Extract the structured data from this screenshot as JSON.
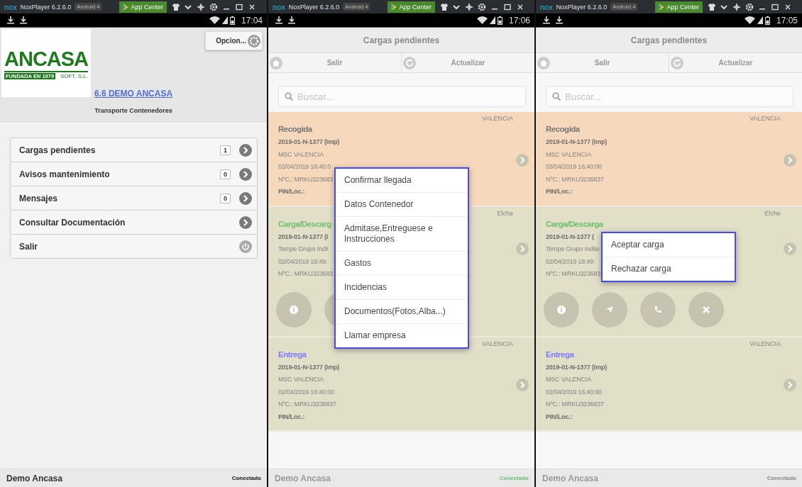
{
  "windows": [
    {
      "logo": "nox",
      "title": "NoxPlayer 6.2.6.0",
      "android": "Android 4",
      "app_center": "App Center",
      "time": "17:04",
      "dimmed": false,
      "screen": {
        "kind": "home",
        "logo": {
          "name": "ANCASA",
          "founded": "FUNDADA EN 1979",
          "company": "SOFT, S.L."
        },
        "options_button": "Opcion...",
        "link": "6.6 DEMO ANCASA",
        "subtitle": "Transporte Contenedores",
        "menu": [
          {
            "label": "Cargas pendientes",
            "count": "1",
            "kind": "arrow"
          },
          {
            "label": "Avisos mantenimiento",
            "count": "0",
            "kind": "arrow"
          },
          {
            "label": "Mensajes",
            "count": "0",
            "kind": "arrow"
          },
          {
            "label": "Consultar Documentación",
            "kind": "arrow"
          },
          {
            "label": "Salir",
            "kind": "power"
          }
        ]
      },
      "footer": {
        "name": "Demo Ancasa",
        "status": "Conectado",
        "color": "#111111"
      }
    },
    {
      "logo": "nox",
      "title": "NoxPlayer 6.2.6.0",
      "android": "Android 4",
      "app_center": "App Center",
      "time": "17:06",
      "dimmed": true,
      "screen": {
        "kind": "list",
        "title": "Cargas pendientes",
        "toolbar": [
          {
            "label": "Salir",
            "kind": "home"
          },
          {
            "label": "Actualizar",
            "kind": "refresh"
          }
        ],
        "search": {
          "placeholder": "Buscar..."
        },
        "cards": [
          {
            "location": "VALENCIA",
            "title": "Recogida",
            "color": "#777777",
            "selected": true,
            "lines": [
              {
                "text": "2019-01-N-1377 (Imp)",
                "kind": "bold"
              },
              {
                "text": "MSC VALENCIA",
                "kind": "plain"
              },
              {
                "text": "03/04/2019 16:40:0",
                "kind": "plain"
              },
              {
                "text": "NºC.: MRKU323683",
                "kind": "plain"
              },
              {
                "text": "PIN/Loc.:",
                "kind": "bold"
              }
            ]
          },
          {
            "location": "Elche",
            "title": "Carga/Descarg",
            "color": "#6dbf6d",
            "selected": false,
            "lines": [
              {
                "text": "2019-01-N-1377 (I",
                "kind": "bold"
              },
              {
                "text": "Tempe Grupo Indit",
                "kind": "plain"
              },
              {
                "text": "02/04/2019 18:49:",
                "kind": "plain"
              },
              {
                "text": "NºC.: MRKU323683",
                "kind": "plain"
              }
            ],
            "actions": [
              {
                "kind": "info"
              },
              {
                "kind": "hidden"
              }
            ]
          },
          {
            "location": "VALENCIA",
            "title": "Entrega",
            "color": "#7b7bff",
            "selected": false,
            "lines": [
              {
                "text": "2019-01-N-1377 (Imp)",
                "kind": "bold"
              },
              {
                "text": "MSC VALENCIA",
                "kind": "plain"
              },
              {
                "text": "02/04/2019 16:40:00",
                "kind": "plain"
              },
              {
                "text": "NºC.: MRKU3236837",
                "kind": "plain"
              },
              {
                "text": "PIN/Loc.:",
                "kind": "bold"
              }
            ]
          }
        ],
        "popup": {
          "items": [
            {
              "label": "Confirmar llegada"
            },
            {
              "label": "Datos Contenedor"
            },
            {
              "label": "Admitase,Entreguese e Instrucciones"
            },
            {
              "label": "Gastos"
            },
            {
              "label": "Incidencias"
            },
            {
              "label": "Documentos(Fotos,Alba...)"
            },
            {
              "label": "Llamar empresa"
            }
          ]
        }
      },
      "footer": {
        "name": "Demo Ancasa",
        "status": "Conectado",
        "color": "#6dbf6d"
      }
    },
    {
      "logo": "nox",
      "title": "NoxPlayer 6.2.6.0",
      "android": "Android 4",
      "app_center": "App Center",
      "time": "17:05",
      "dimmed": true,
      "screen": {
        "kind": "list",
        "title": "Cargas pendientes",
        "toolbar": [
          {
            "label": "Salir",
            "kind": "home"
          },
          {
            "label": "Actualizar",
            "kind": "refresh"
          }
        ],
        "search": {
          "placeholder": "Buscar..."
        },
        "cards": [
          {
            "location": "VALENCIA",
            "title": "Recogida",
            "color": "#777777",
            "selected": true,
            "lines": [
              {
                "text": "2019-01-N-1377 (Imp)",
                "kind": "bold"
              },
              {
                "text": "MSC VALENCIA",
                "kind": "plain"
              },
              {
                "text": "03/04/2019 16:40:00",
                "kind": "plain"
              },
              {
                "text": "NºC.: MRKU3236837",
                "kind": "plain"
              },
              {
                "text": "PIN/Loc.:",
                "kind": "bold"
              }
            ]
          },
          {
            "location": "Elche",
            "title": "Carga/Descarga",
            "color": "#6dbf6d",
            "selected": false,
            "lines": [
              {
                "text": "2019-01-N-1377 (",
                "kind": "bold"
              },
              {
                "text": "Tempe Grupo Indite",
                "kind": "plain"
              },
              {
                "text": "02/04/2019 18:49:",
                "kind": "plain"
              },
              {
                "text": "NºC.: MRKU323683",
                "kind": "plain"
              }
            ],
            "actions": [
              {
                "kind": "info"
              },
              {
                "kind": "navigate"
              },
              {
                "kind": "phone"
              },
              {
                "kind": "close"
              }
            ]
          },
          {
            "location": "VALENCIA",
            "title": "Entrega",
            "color": "#7b7bff",
            "selected": false,
            "lines": [
              {
                "text": "2019-01-N-1377 (Imp)",
                "kind": "bold"
              },
              {
                "text": "MSC VALENCIA",
                "kind": "plain"
              },
              {
                "text": "02/04/2019 16:40:00",
                "kind": "plain"
              },
              {
                "text": "NºC.: MRKU3236837",
                "kind": "plain"
              },
              {
                "text": "PIN/Loc.:",
                "kind": "bold"
              }
            ]
          }
        ],
        "popup": {
          "items": [
            {
              "label": "Aceptar carga"
            },
            {
              "label": "Rechazar carga"
            }
          ]
        }
      },
      "footer": {
        "name": "Demo Ancasa",
        "status": "Conectado",
        "color": "#888888"
      }
    }
  ]
}
